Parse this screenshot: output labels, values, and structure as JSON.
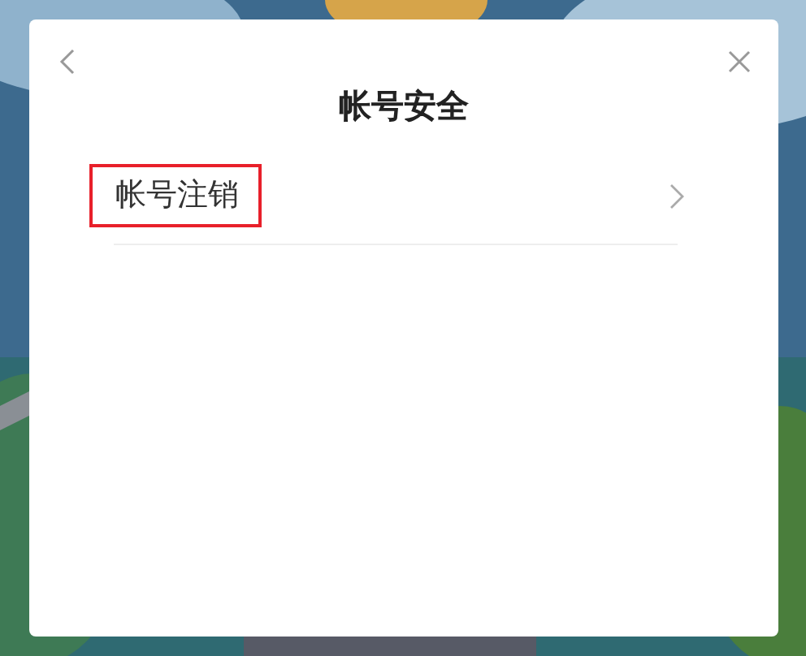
{
  "dialog": {
    "title": "帐号安全",
    "items": [
      {
        "label": "帐号注销",
        "highlighted": true
      }
    ]
  }
}
